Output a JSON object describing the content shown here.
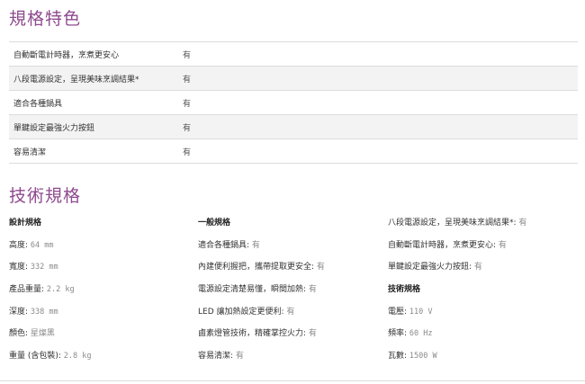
{
  "features": {
    "title": "規格特色",
    "rows": [
      {
        "name": "自動斷電計時器，烹煮更安心",
        "value": "有"
      },
      {
        "name": "八段電源設定，呈現美味烹調結果*",
        "value": "有"
      },
      {
        "name": "適合各種鍋具",
        "value": "有"
      },
      {
        "name": "單鍵設定最強火力按鈕",
        "value": "有"
      },
      {
        "name": "容易清潔",
        "value": "有"
      }
    ]
  },
  "tech": {
    "title": "技術規格",
    "col1": {
      "heading": "設計規格",
      "items": [
        {
          "label": "高度: ",
          "value": "64 mm"
        },
        {
          "label": "寬度: ",
          "value": "332 mm"
        },
        {
          "label": "產品重量: ",
          "value": "2.2 kg"
        },
        {
          "label": "深度: ",
          "value": "338 mm"
        },
        {
          "label": "顏色: ",
          "value": "星燦黑"
        },
        {
          "label": "重量 (含包裝): ",
          "value": "2.8 kg"
        }
      ]
    },
    "col2": {
      "heading": "一般規格",
      "items": [
        {
          "label": "適合各種鍋具: ",
          "value": "有"
        },
        {
          "label": "內建便利握把，攜帶提取更安全: ",
          "value": "有"
        },
        {
          "label": "電源設定清楚易懂，瞬間加熱: ",
          "value": "有"
        },
        {
          "label": "LED 讓加熱設定更便利: ",
          "value": "有"
        },
        {
          "label": "鹵素燈管技術，精確掌控火力: ",
          "value": "有"
        },
        {
          "label": "容易清潔: ",
          "value": "有"
        }
      ]
    },
    "col3": {
      "items_top": [
        {
          "label": "八段電源設定，呈現美味烹調結果*: ",
          "value": "有"
        },
        {
          "label": "自動斷電計時器，烹煮更安心: ",
          "value": "有"
        },
        {
          "label": "單鍵設定最強火力按鈕: ",
          "value": "有"
        }
      ],
      "heading": "技術規格",
      "items_bottom": [
        {
          "label": "電壓: ",
          "value": "110 V"
        },
        {
          "label": "頻率: ",
          "value": "60 Hz"
        },
        {
          "label": "瓦數: ",
          "value": "1500 W"
        }
      ]
    }
  },
  "colors": {
    "section_title": "#8e4a8e",
    "row_stripe": "#f3f3f3",
    "divider": "#dcdcdc",
    "value_gray": "#8a8a8a"
  }
}
